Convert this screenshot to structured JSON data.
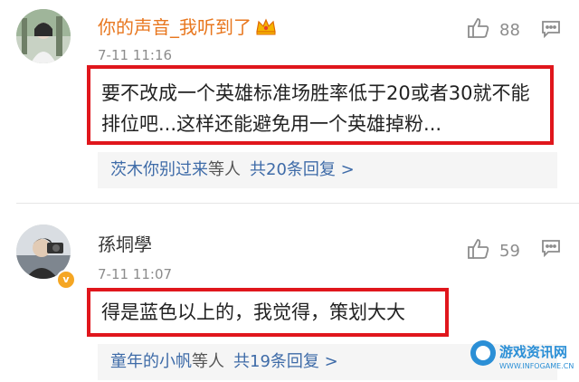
{
  "comments": [
    {
      "username": "你的声音_我听到了",
      "time": "7-11 11:16",
      "likes": "88",
      "text": "要不改成一个英雄标准场胜率低于20或者30就不能排位吧...这样还能避免用一个英雄掉粉...",
      "replies": {
        "names": "茨木你别过来",
        "etc": "等人",
        "count": "共20条回复 >"
      }
    },
    {
      "username": "孫垌學",
      "time": "7-11 11:07",
      "likes": "59",
      "text": "得是蓝色以上的，我觉得，策划大大",
      "replies": {
        "names": "童年的小帆",
        "etc": "等人",
        "count": "共19条回复 >"
      }
    }
  ],
  "watermark": {
    "title": "游戏资讯网",
    "url": "WWW.INFOGAME.CN"
  },
  "colors": {
    "highlight_border": "#e0161c",
    "member_name": "#e8771f",
    "link": "#3e6ba8",
    "meta": "#8c8c8c"
  },
  "icons": [
    "thumbs-up-icon",
    "more-message-icon",
    "crown-icon",
    "verified-badge-icon"
  ]
}
